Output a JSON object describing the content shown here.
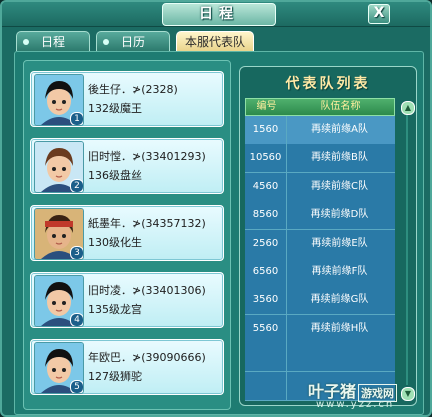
{
  "window": {
    "title": "日程",
    "close_label": "X"
  },
  "tabs": [
    {
      "label": "日程",
      "active": false
    },
    {
      "label": "日历",
      "active": false
    },
    {
      "label": "本服代表队",
      "active": true
    }
  ],
  "members": [
    {
      "name": "後生仔．≯",
      "id": "(2328)",
      "info": "132级魔王",
      "badge": "1",
      "avatar": "male-black-hair"
    },
    {
      "name": "旧时憆．≯",
      "id": "(33401293)",
      "info": "136级盘丝",
      "badge": "2",
      "avatar": "female-brown-hair"
    },
    {
      "name": "紙墨年．≯",
      "id": "(34357132)",
      "info": "130级化生",
      "badge": "3",
      "avatar": "male-bandana"
    },
    {
      "name": "旧时凌．≯",
      "id": "(33401306)",
      "info": "135级龙宫",
      "badge": "4",
      "avatar": "male-black-hair"
    },
    {
      "name": "年欧巴．≯",
      "id": "(39090666)",
      "info": "127级狮驼",
      "badge": "5",
      "avatar": "male-black-hair"
    }
  ],
  "team_list": {
    "title": "代表队列表",
    "headers": [
      "编号",
      "队伍名称"
    ],
    "rows": [
      {
        "id": "1560",
        "name": "再续前缘A队"
      },
      {
        "id": "10560",
        "name": "再续前缘B队"
      },
      {
        "id": "4560",
        "name": "再续前缘C队"
      },
      {
        "id": "8560",
        "name": "再续前缘D队"
      },
      {
        "id": "2560",
        "name": "再续前缘E队"
      },
      {
        "id": "6560",
        "name": "再续前缘F队"
      },
      {
        "id": "3560",
        "name": "再续前缘G队"
      },
      {
        "id": "5560",
        "name": "再续前缘H队"
      }
    ],
    "selected_index": 0
  },
  "watermark": {
    "main": "叶子猪",
    "box": "游戏网",
    "url": "www.yzz.cn"
  },
  "colors": {
    "panel": "#1b6b63",
    "row": "#2a7aa7",
    "row_selected": "#4a98c4",
    "header": "#2d8a4c"
  }
}
